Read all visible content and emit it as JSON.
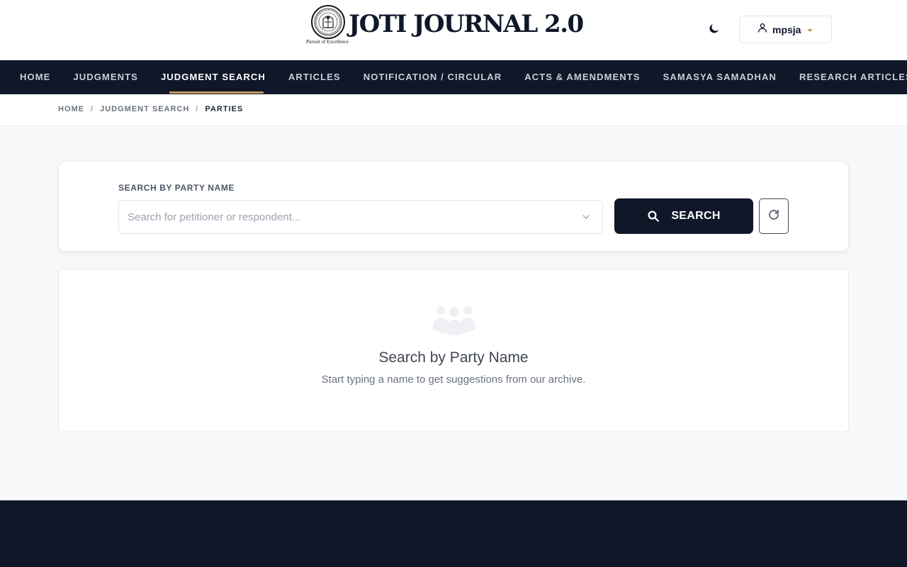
{
  "header": {
    "logo_title": "JOTI JOURNAL 2.0",
    "logo_tagline": "Pursuit of Excellence",
    "theme_icon": "moon-icon",
    "user": {
      "icon": "user-icon",
      "name": "mpsja",
      "caret_color": "#c39a5d"
    }
  },
  "nav": {
    "items": [
      {
        "label": "HOME",
        "active": false
      },
      {
        "label": "JUDGMENTS",
        "active": false
      },
      {
        "label": "JUDGMENT SEARCH",
        "active": true
      },
      {
        "label": "ARTICLES",
        "active": false
      },
      {
        "label": "NOTIFICATION / CIRCULAR",
        "active": false
      },
      {
        "label": "ACTS & AMENDMENTS",
        "active": false
      },
      {
        "label": "SAMASYA SAMADHAN",
        "active": false
      },
      {
        "label": "RESEARCH ARTICLES",
        "active": false
      }
    ],
    "accent_color": "#c39a5d",
    "background": "#0f1729"
  },
  "breadcrumb": {
    "items": [
      "HOME",
      "JUDGMENT SEARCH",
      "PARTIES"
    ],
    "separator": "/"
  },
  "search": {
    "label": "SEARCH BY PARTY NAME",
    "placeholder": "Search for petitioner or respondent...",
    "value": "",
    "button_label": "SEARCH",
    "button_icon": "search-icon",
    "reset_icon": "refresh-icon"
  },
  "empty_state": {
    "icon": "users-group-icon",
    "title": "Search by Party Name",
    "subtitle": "Start typing a name to get suggestions from our archive."
  }
}
